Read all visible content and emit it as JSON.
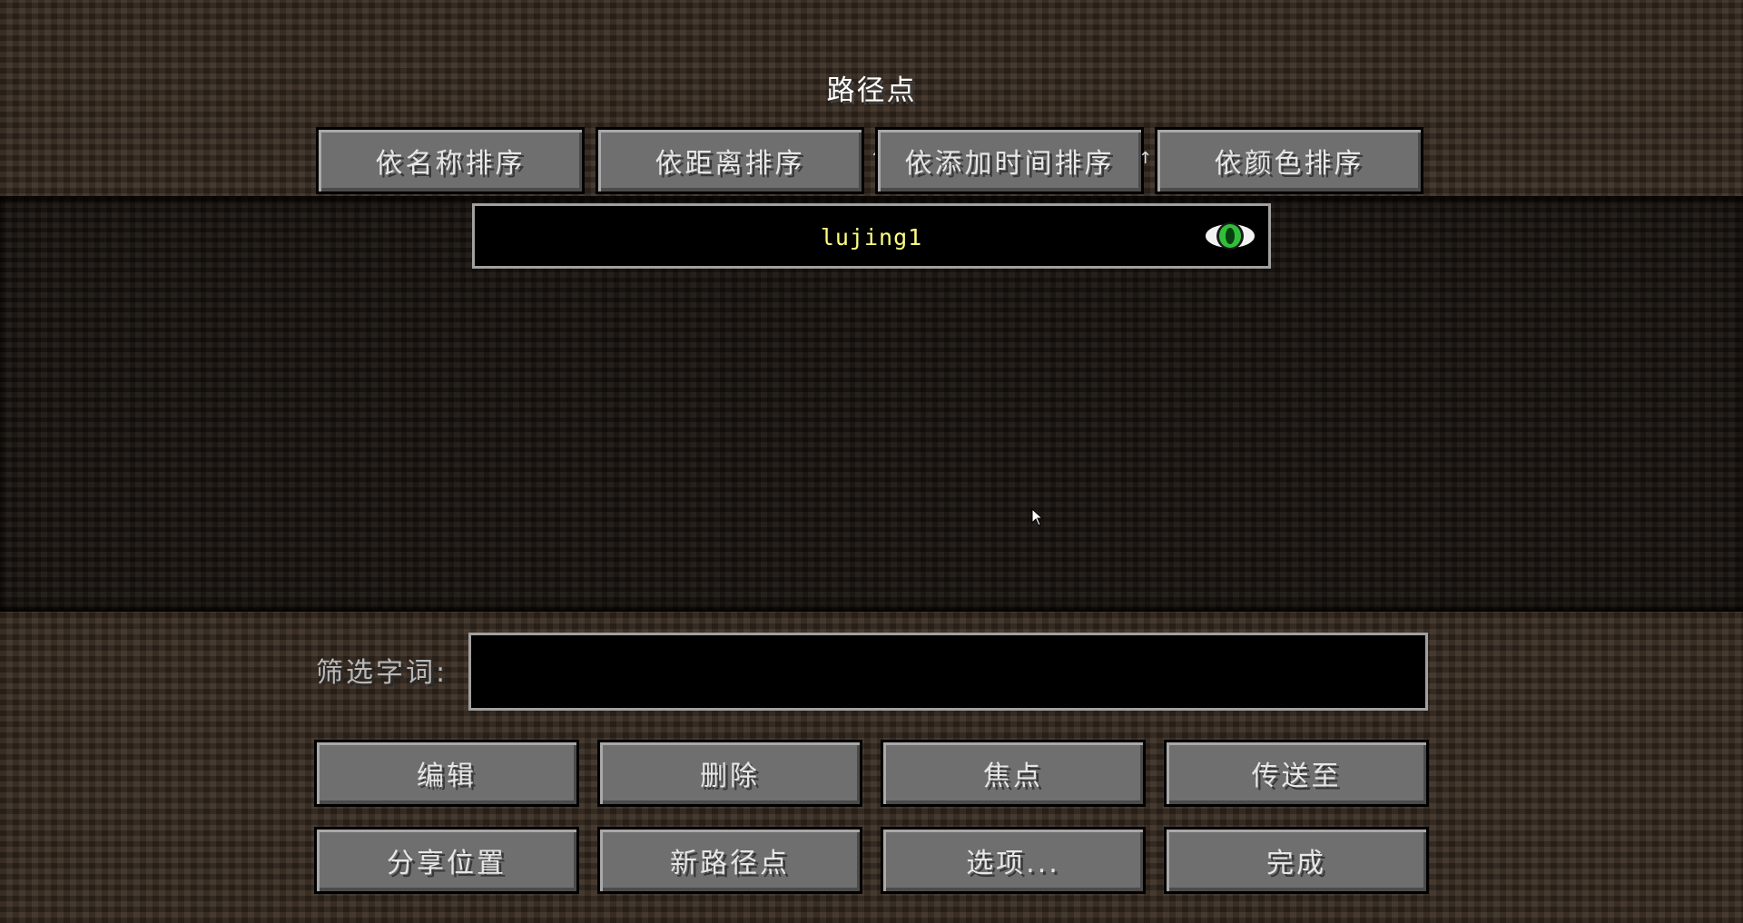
{
  "title": "路径点",
  "sort_buttons": {
    "by_name": "依名称排序",
    "by_distance": "依距离排序",
    "by_added_time": "依添加时间排序",
    "by_color": "依颜色排序",
    "arrow_left": "↑",
    "arrow_right": "↑"
  },
  "waypoints": [
    {
      "name": "lujing1",
      "visible_icon": "eye-icon",
      "name_color": "#ffff80"
    }
  ],
  "filter": {
    "label": "筛选字词:",
    "value": ""
  },
  "actions": {
    "edit": "编辑",
    "delete": "删除",
    "focus": "焦点",
    "teleport": "传送至",
    "share_location": "分享位置",
    "new_waypoint": "新路径点",
    "options": "选项...",
    "done": "完成"
  }
}
